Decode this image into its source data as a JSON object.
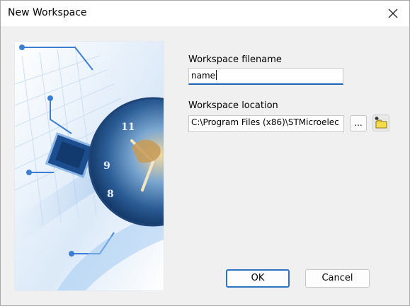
{
  "window": {
    "title": "New Workspace",
    "close_icon": "close-icon"
  },
  "form": {
    "filename_label": "Workspace filename",
    "filename_value": "name",
    "location_label": "Workspace location",
    "location_value": "C:\\Program Files (x86)\\STMicroelec",
    "browse_label": "...",
    "new_folder_icon": "new-folder-icon"
  },
  "buttons": {
    "ok_label": "OK",
    "cancel_label": "Cancel"
  },
  "image": {
    "description_icon": "workspace-illustration"
  },
  "colors": {
    "accent": "#1f63b4",
    "dialog_bg": "#f0f0f0"
  }
}
